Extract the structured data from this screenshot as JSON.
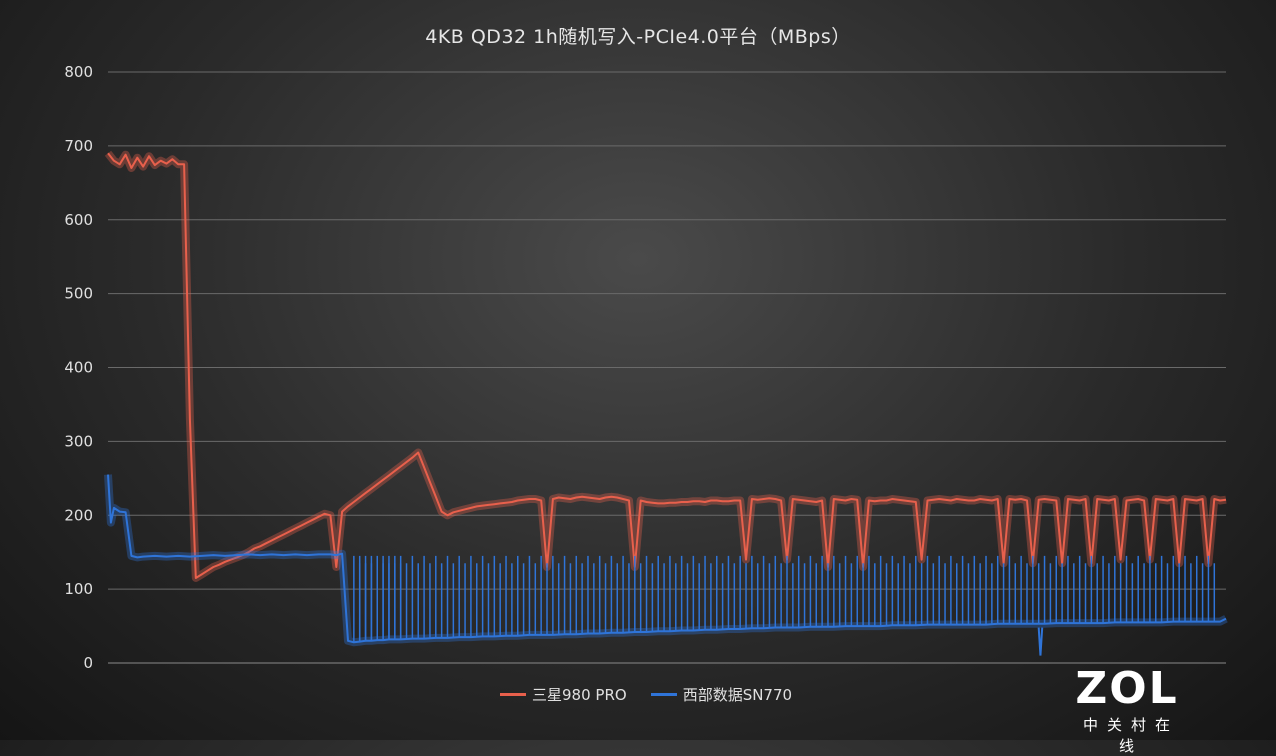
{
  "chart_data": {
    "type": "line",
    "title": "4KB QD32 1h随机写入-PCIe4.0平台（MBps）",
    "xlabel": "",
    "ylabel": "",
    "ylim": [
      0,
      800
    ],
    "yticks": [
      0,
      100,
      200,
      300,
      400,
      500,
      600,
      700,
      800
    ],
    "grid": true,
    "legend_position": "bottom",
    "series": [
      {
        "name": "三星980 PRO",
        "color": "#e8604c",
        "points": [
          [
            0,
            690
          ],
          [
            1,
            680
          ],
          [
            2,
            675
          ],
          [
            3,
            688
          ],
          [
            4,
            670
          ],
          [
            5,
            684
          ],
          [
            6,
            672
          ],
          [
            7,
            686
          ],
          [
            8,
            674
          ],
          [
            9,
            680
          ],
          [
            10,
            676
          ],
          [
            11,
            682
          ],
          [
            12,
            675
          ],
          [
            13,
            675
          ],
          [
            14,
            330
          ],
          [
            15,
            115
          ],
          [
            16,
            120
          ],
          [
            17,
            125
          ],
          [
            18,
            130
          ],
          [
            19,
            133
          ],
          [
            20,
            137
          ],
          [
            21,
            140
          ],
          [
            22,
            143
          ],
          [
            23,
            146
          ],
          [
            24,
            150
          ],
          [
            25,
            155
          ],
          [
            26,
            158
          ],
          [
            27,
            162
          ],
          [
            28,
            166
          ],
          [
            29,
            170
          ],
          [
            30,
            174
          ],
          [
            31,
            178
          ],
          [
            32,
            182
          ],
          [
            33,
            186
          ],
          [
            34,
            190
          ],
          [
            35,
            194
          ],
          [
            36,
            198
          ],
          [
            37,
            202
          ],
          [
            38,
            200
          ],
          [
            39,
            130
          ],
          [
            40,
            205
          ],
          [
            41,
            212
          ],
          [
            42,
            218
          ],
          [
            43,
            224
          ],
          [
            44,
            230
          ],
          [
            45,
            236
          ],
          [
            46,
            242
          ],
          [
            47,
            248
          ],
          [
            48,
            254
          ],
          [
            49,
            260
          ],
          [
            50,
            266
          ],
          [
            51,
            272
          ],
          [
            52,
            278
          ],
          [
            53,
            285
          ],
          [
            54,
            265
          ],
          [
            55,
            245
          ],
          [
            56,
            225
          ],
          [
            57,
            205
          ],
          [
            58,
            200
          ],
          [
            59,
            204
          ],
          [
            60,
            206
          ],
          [
            61,
            208
          ],
          [
            62,
            210
          ],
          [
            63,
            212
          ],
          [
            64,
            213
          ],
          [
            65,
            214
          ],
          [
            66,
            215
          ],
          [
            67,
            216
          ],
          [
            68,
            217
          ],
          [
            69,
            218
          ],
          [
            70,
            220
          ],
          [
            71,
            221
          ],
          [
            72,
            222
          ],
          [
            73,
            222
          ],
          [
            74,
            220
          ],
          [
            75,
            130
          ],
          [
            76,
            222
          ],
          [
            77,
            224
          ],
          [
            78,
            223
          ],
          [
            79,
            222
          ],
          [
            80,
            224
          ],
          [
            81,
            225
          ],
          [
            82,
            224
          ],
          [
            83,
            223
          ],
          [
            84,
            222
          ],
          [
            85,
            224
          ],
          [
            86,
            225
          ],
          [
            87,
            224
          ],
          [
            88,
            222
          ],
          [
            89,
            220
          ],
          [
            90,
            130
          ],
          [
            91,
            220
          ],
          [
            92,
            218
          ],
          [
            93,
            217
          ],
          [
            94,
            216
          ],
          [
            95,
            216
          ],
          [
            96,
            217
          ],
          [
            97,
            217
          ],
          [
            98,
            218
          ],
          [
            99,
            218
          ],
          [
            100,
            219
          ],
          [
            101,
            219
          ],
          [
            102,
            218
          ],
          [
            103,
            220
          ],
          [
            104,
            220
          ],
          [
            105,
            219
          ],
          [
            106,
            219
          ],
          [
            107,
            220
          ],
          [
            108,
            220
          ],
          [
            109,
            140
          ],
          [
            110,
            222
          ],
          [
            111,
            221
          ],
          [
            112,
            222
          ],
          [
            113,
            223
          ],
          [
            114,
            222
          ],
          [
            115,
            220
          ],
          [
            116,
            140
          ],
          [
            117,
            222
          ],
          [
            118,
            221
          ],
          [
            119,
            220
          ],
          [
            120,
            219
          ],
          [
            121,
            218
          ],
          [
            122,
            220
          ],
          [
            123,
            130
          ],
          [
            124,
            222
          ],
          [
            125,
            221
          ],
          [
            126,
            220
          ],
          [
            127,
            222
          ],
          [
            128,
            221
          ],
          [
            129,
            130
          ],
          [
            130,
            220
          ],
          [
            131,
            219
          ],
          [
            132,
            220
          ],
          [
            133,
            220
          ],
          [
            134,
            222
          ],
          [
            135,
            221
          ],
          [
            136,
            220
          ],
          [
            137,
            219
          ],
          [
            138,
            218
          ],
          [
            139,
            140
          ],
          [
            140,
            220
          ],
          [
            141,
            221
          ],
          [
            142,
            222
          ],
          [
            143,
            221
          ],
          [
            144,
            220
          ],
          [
            145,
            222
          ],
          [
            146,
            221
          ],
          [
            147,
            220
          ],
          [
            148,
            220
          ],
          [
            149,
            222
          ],
          [
            150,
            221
          ],
          [
            151,
            220
          ],
          [
            152,
            222
          ],
          [
            153,
            135
          ],
          [
            154,
            222
          ],
          [
            155,
            221
          ],
          [
            156,
            222
          ],
          [
            157,
            220
          ],
          [
            158,
            135
          ],
          [
            159,
            221
          ],
          [
            160,
            222
          ],
          [
            161,
            221
          ],
          [
            162,
            220
          ],
          [
            163,
            135
          ],
          [
            164,
            222
          ],
          [
            165,
            221
          ],
          [
            166,
            220
          ],
          [
            167,
            222
          ],
          [
            168,
            135
          ],
          [
            169,
            222
          ],
          [
            170,
            221
          ],
          [
            171,
            220
          ],
          [
            172,
            222
          ],
          [
            173,
            140
          ],
          [
            174,
            220
          ],
          [
            175,
            221
          ],
          [
            176,
            222
          ],
          [
            177,
            220
          ],
          [
            178,
            140
          ],
          [
            179,
            222
          ],
          [
            180,
            221
          ],
          [
            181,
            220
          ],
          [
            182,
            222
          ],
          [
            183,
            135
          ],
          [
            184,
            222
          ],
          [
            185,
            221
          ],
          [
            186,
            220
          ],
          [
            187,
            222
          ],
          [
            188,
            135
          ],
          [
            189,
            222
          ],
          [
            190,
            220
          ],
          [
            191,
            221
          ]
        ]
      },
      {
        "name": "西部数据SN770",
        "color": "#2f74d8",
        "points": [
          [
            0,
            255
          ],
          [
            0.5,
            190
          ],
          [
            1,
            210
          ],
          [
            2,
            205
          ],
          [
            3,
            204
          ],
          [
            4,
            145
          ],
          [
            5,
            143
          ],
          [
            6,
            144
          ],
          [
            8,
            145
          ],
          [
            10,
            144
          ],
          [
            12,
            145
          ],
          [
            14,
            144
          ],
          [
            16,
            145
          ],
          [
            18,
            146
          ],
          [
            20,
            145
          ],
          [
            22,
            146
          ],
          [
            24,
            147
          ],
          [
            26,
            146
          ],
          [
            28,
            147
          ],
          [
            30,
            146
          ],
          [
            32,
            147
          ],
          [
            34,
            146
          ],
          [
            36,
            147
          ],
          [
            38,
            147
          ],
          [
            39,
            146
          ],
          [
            40,
            148
          ],
          [
            41,
            30
          ],
          [
            42,
            28
          ],
          [
            43,
            29
          ],
          [
            44,
            30
          ],
          [
            45,
            30
          ],
          [
            46,
            31
          ],
          [
            47,
            31
          ],
          [
            48,
            32
          ],
          [
            49,
            32
          ],
          [
            50,
            32
          ],
          [
            52,
            33
          ],
          [
            54,
            33
          ],
          [
            56,
            34
          ],
          [
            58,
            34
          ],
          [
            60,
            35
          ],
          [
            62,
            35
          ],
          [
            64,
            36
          ],
          [
            66,
            36
          ],
          [
            68,
            37
          ],
          [
            70,
            37
          ],
          [
            72,
            38
          ],
          [
            74,
            38
          ],
          [
            76,
            38
          ],
          [
            78,
            39
          ],
          [
            80,
            39
          ],
          [
            82,
            40
          ],
          [
            84,
            40
          ],
          [
            86,
            41
          ],
          [
            88,
            41
          ],
          [
            90,
            42
          ],
          [
            92,
            42
          ],
          [
            94,
            43
          ],
          [
            96,
            43
          ],
          [
            98,
            44
          ],
          [
            100,
            44
          ],
          [
            102,
            45
          ],
          [
            104,
            45
          ],
          [
            106,
            46
          ],
          [
            108,
            46
          ],
          [
            110,
            47
          ],
          [
            112,
            47
          ],
          [
            114,
            48
          ],
          [
            116,
            48
          ],
          [
            118,
            48
          ],
          [
            120,
            49
          ],
          [
            122,
            49
          ],
          [
            124,
            49
          ],
          [
            126,
            50
          ],
          [
            128,
            50
          ],
          [
            130,
            50
          ],
          [
            132,
            50
          ],
          [
            134,
            51
          ],
          [
            136,
            51
          ],
          [
            138,
            51
          ],
          [
            140,
            52
          ],
          [
            142,
            52
          ],
          [
            144,
            52
          ],
          [
            146,
            52
          ],
          [
            148,
            52
          ],
          [
            150,
            52
          ],
          [
            152,
            53
          ],
          [
            154,
            53
          ],
          [
            156,
            53
          ],
          [
            158,
            53
          ],
          [
            160,
            53
          ],
          [
            162,
            54
          ],
          [
            164,
            54
          ],
          [
            166,
            54
          ],
          [
            168,
            54
          ],
          [
            170,
            54
          ],
          [
            172,
            55
          ],
          [
            174,
            55
          ],
          [
            176,
            55
          ],
          [
            178,
            55
          ],
          [
            180,
            55
          ],
          [
            182,
            56
          ],
          [
            184,
            56
          ],
          [
            186,
            56
          ],
          [
            188,
            56
          ],
          [
            190,
            56
          ],
          [
            191,
            60
          ]
        ],
        "dip": [
          [
            159,
            48
          ],
          [
            159.3,
            10
          ],
          [
            159.6,
            48
          ]
        ]
      }
    ]
  },
  "watermark": {
    "brand": "ZOL",
    "tagline": "中关村在线"
  }
}
